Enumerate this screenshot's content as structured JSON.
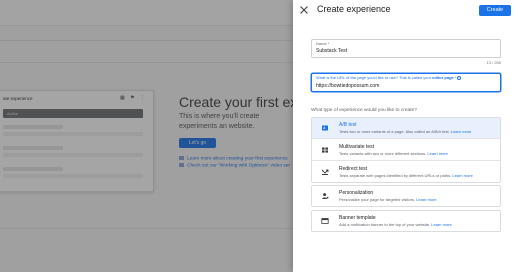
{
  "background": {
    "mock_title": "ate experience",
    "mock_bar_text": "Active",
    "heading": "Create your first experien",
    "description": "This is where you'll create experiments an website.",
    "lets_go_label": "Let's go",
    "link_1": "Learn more about creating your first experience",
    "link_2": "Check out our \"Working with Optimize\" video ser"
  },
  "panel": {
    "title": "Create experience",
    "create_label": "Create",
    "name_field": {
      "label": "Name *",
      "value": "Substack Test",
      "counter": "13 / 255"
    },
    "url_field": {
      "label_prefix": "What is the URL of the page you'd like to use? This is called your ",
      "label_bold": "editor page",
      "label_suffix": " *",
      "value": "https://bowtiedopossum.com"
    },
    "type_question": "What type of experience would you like to create?",
    "options": [
      {
        "title": "A/B test",
        "description": "Tests two or more variants of a page. Also called an A/B/n test.",
        "learn": "Learn more",
        "icon": "ab-test-icon",
        "selected": true
      },
      {
        "title": "Multivariate test",
        "description": "Tests variants with two or more different sections.",
        "learn": "Learn more",
        "icon": "grid-icon"
      },
      {
        "title": "Redirect test",
        "description": "Tests separate web pages identified by different URLs or paths.",
        "learn": "Learn more",
        "icon": "redirect-icon"
      },
      {
        "title": "Personalization",
        "description": "Personalize your page for targeted visitors.",
        "learn": "Learn more",
        "icon": "person-icon"
      },
      {
        "title": "Banner template",
        "description": "Add a notification banner to the top of your website.",
        "learn": "Learn more",
        "icon": "banner-icon"
      }
    ]
  },
  "colors": {
    "accent": "#1a73e8",
    "selected_bg": "#e8f0fe"
  }
}
